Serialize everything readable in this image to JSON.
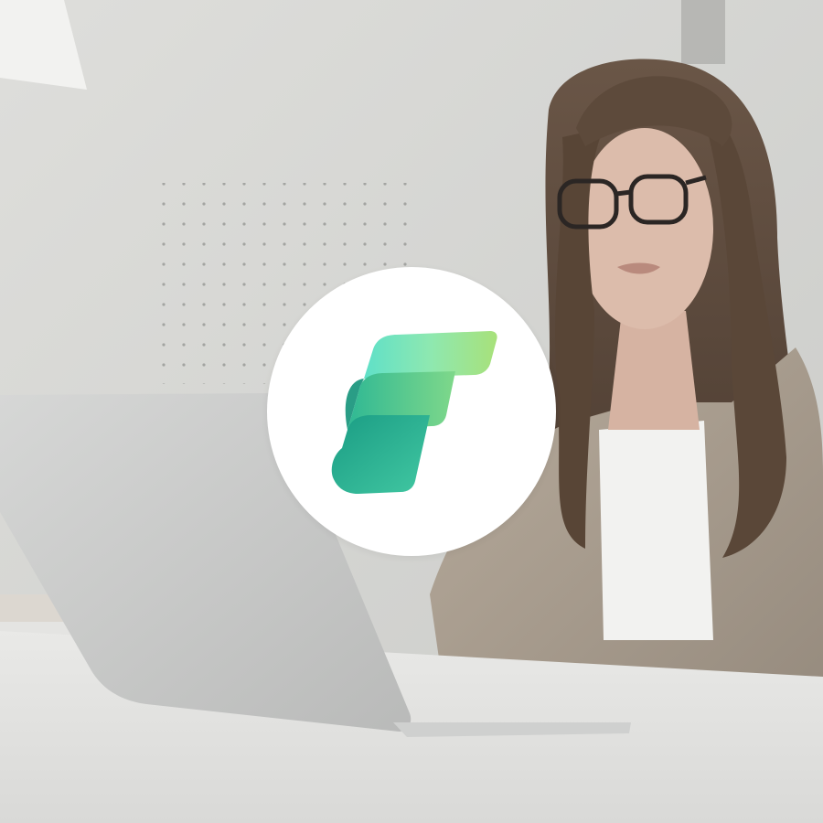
{
  "scene": {
    "description_icon": "photo-background",
    "colors": {
      "wall": "#d3d3d0",
      "desk": "#e6e6e4",
      "laptop": "#c9cac8",
      "jacket": "#a89d8f",
      "shirt": "#f1f1ef",
      "hair": "#5d4a3c",
      "skin": "#d9b8a7"
    }
  },
  "logo": {
    "icon": "fabric-logo-icon",
    "colors": {
      "top_light": "#6fe3c4",
      "top_dark": "#9be07a",
      "mid_light": "#3fc6a0",
      "mid_dark": "#7ad38a",
      "bottom_light": "#1ea58a",
      "bottom_dark": "#3fc09c"
    }
  }
}
